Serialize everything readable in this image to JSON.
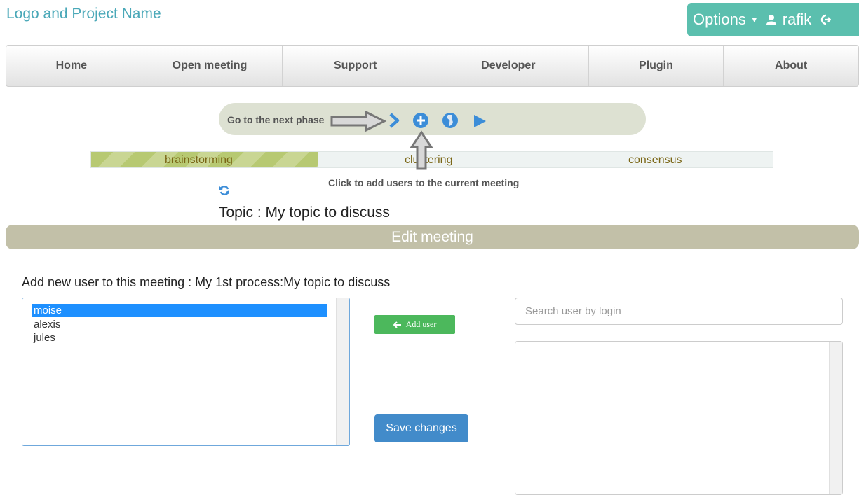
{
  "brand": "Logo and Project Name",
  "account": {
    "options_label": "Options",
    "username": "rafik"
  },
  "nav": [
    "Home",
    "Open meeting",
    "Support",
    "Developer",
    "Plugin",
    "About"
  ],
  "phase": {
    "next_label": "Go to the next phase"
  },
  "stages": {
    "items": [
      "brainstorming",
      "clustering",
      "consensus"
    ],
    "progress_percent": 33.3
  },
  "hint": "Click to add users to the current meeting",
  "topic": "Topic : My topic to discuss",
  "edit_title": "Edit meeting",
  "add_label": "Add new user to this meeting : My 1st process:My topic to discuss",
  "users": [
    "moise",
    "alexis",
    "jules"
  ],
  "selected_user": "moise",
  "buttons": {
    "add_user": "Add user",
    "save": "Save changes"
  },
  "search": {
    "placeholder": "Search user by login",
    "value": ""
  },
  "colors": {
    "accent": "#5bbfae",
    "primary": "#428bca",
    "success": "#4cb85c",
    "icon_blue": "#3c8dd8"
  }
}
